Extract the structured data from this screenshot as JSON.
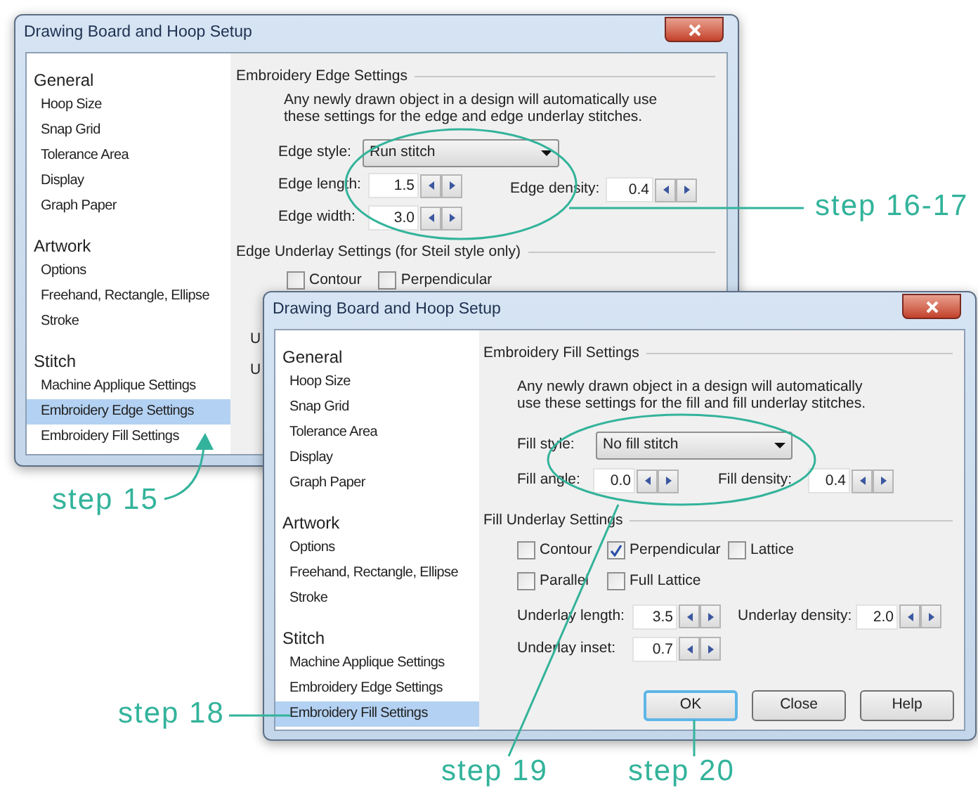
{
  "back_window": {
    "title": "Drawing Board and Hoop Setup",
    "sidebar": [
      {
        "heading": "General",
        "items": [
          {
            "label": "Hoop Size",
            "selected": false
          },
          {
            "label": "Snap Grid",
            "selected": false
          },
          {
            "label": "Tolerance Area",
            "selected": false
          },
          {
            "label": "Display",
            "selected": false
          },
          {
            "label": "Graph Paper",
            "selected": false
          }
        ]
      },
      {
        "heading": "Artwork",
        "items": [
          {
            "label": "Options",
            "selected": false
          },
          {
            "label": "Freehand, Rectangle, Ellipse",
            "selected": false
          },
          {
            "label": "Stroke",
            "selected": false
          }
        ]
      },
      {
        "heading": "Stitch",
        "items": [
          {
            "label": "Machine Applique Settings",
            "selected": false
          },
          {
            "label": "Embroidery Edge Settings",
            "selected": true
          },
          {
            "label": "Embroidery Fill Settings",
            "selected": false
          }
        ]
      }
    ],
    "section_title": "Embroidery Edge Settings",
    "description_lines": [
      "Any newly drawn object in a design will automatically use",
      "these settings for the edge and edge underlay stitches."
    ],
    "edge_style": {
      "label": "Edge style:",
      "value": "Run stitch"
    },
    "edge_length": {
      "label": "Edge length:",
      "value": "1.5"
    },
    "edge_width": {
      "label": "Edge width:",
      "value": "3.0"
    },
    "edge_density": {
      "label": "Edge density:",
      "value": "0.4"
    },
    "underlay_title": "Edge Underlay Settings (for Steil style only)",
    "underlay_options": [
      {
        "label": "Contour",
        "checked": false
      },
      {
        "label": "Perpendicular",
        "checked": false
      }
    ],
    "cut_labels": [
      "U",
      "U"
    ]
  },
  "front_window": {
    "title": "Drawing Board and Hoop Setup",
    "sidebar": [
      {
        "heading": "General",
        "items": [
          {
            "label": "Hoop Size",
            "selected": false
          },
          {
            "label": "Snap Grid",
            "selected": false
          },
          {
            "label": "Tolerance Area",
            "selected": false
          },
          {
            "label": "Display",
            "selected": false
          },
          {
            "label": "Graph Paper",
            "selected": false
          }
        ]
      },
      {
        "heading": "Artwork",
        "items": [
          {
            "label": "Options",
            "selected": false
          },
          {
            "label": "Freehand, Rectangle, Ellipse",
            "selected": false
          },
          {
            "label": "Stroke",
            "selected": false
          }
        ]
      },
      {
        "heading": "Stitch",
        "items": [
          {
            "label": "Machine Applique Settings",
            "selected": false
          },
          {
            "label": "Embroidery Edge Settings",
            "selected": false
          },
          {
            "label": "Embroidery Fill Settings",
            "selected": true
          }
        ]
      }
    ],
    "section_title": "Embroidery Fill Settings",
    "description_lines": [
      "Any newly drawn object in a design will automatically",
      "use these settings for the fill and fill underlay stitches."
    ],
    "fill_style": {
      "label": "Fill style:",
      "value": "No fill stitch"
    },
    "fill_angle": {
      "label": "Fill angle:",
      "value": "0.0"
    },
    "fill_density": {
      "label": "Fill density:",
      "value": "0.4"
    },
    "underlay_title": "Fill Underlay Settings",
    "underlay_option_rows": [
      [
        {
          "label": "Contour",
          "checked": false
        },
        {
          "label": "Perpendicular",
          "checked": true
        },
        {
          "label": "Lattice",
          "checked": false
        }
      ],
      [
        {
          "label": "Parallel",
          "checked": false
        },
        {
          "label": "Full Lattice",
          "checked": false
        }
      ]
    ],
    "underlay_length": {
      "label": "Underlay length:",
      "value": "3.5"
    },
    "underlay_density": {
      "label": "Underlay density:",
      "value": "2.0"
    },
    "underlay_inset": {
      "label": "Underlay inset:",
      "value": "0.7"
    },
    "buttons": [
      {
        "label": "OK",
        "default": true
      },
      {
        "label": "Close",
        "default": false
      },
      {
        "label": "Help",
        "default": false
      }
    ]
  },
  "annotations": [
    {
      "text": "step 16-17"
    },
    {
      "text": "step 15"
    },
    {
      "text": "step 18"
    },
    {
      "text": "step 19"
    },
    {
      "text": "step 20"
    }
  ]
}
